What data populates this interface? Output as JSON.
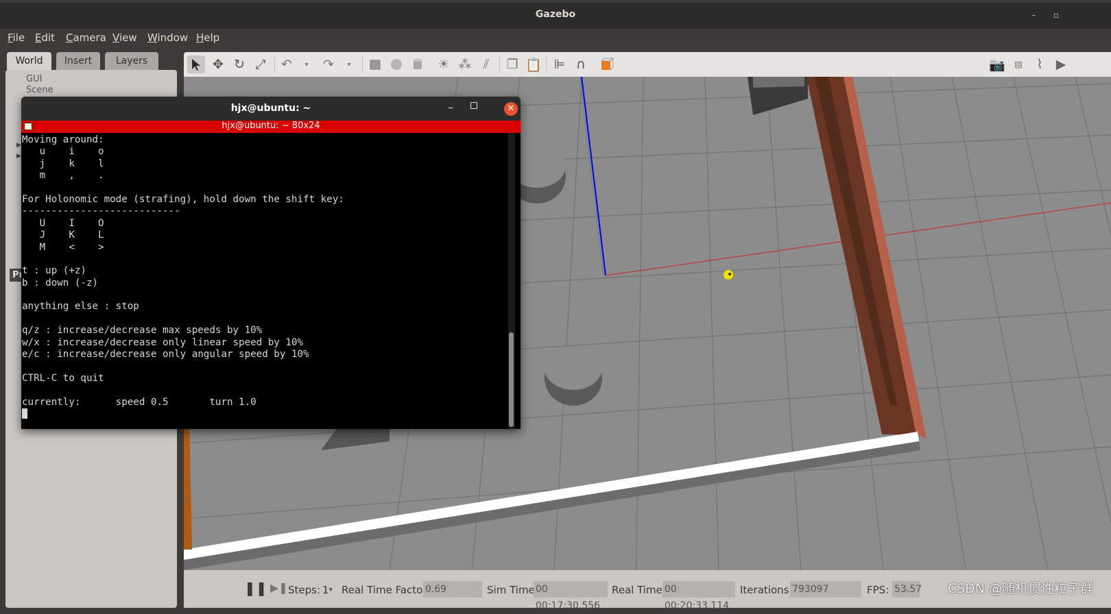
{
  "window": {
    "title": "Gazebo",
    "controls": [
      "–",
      "▫"
    ]
  },
  "menu": [
    "File",
    "Edit",
    "Camera",
    "View",
    "Window",
    "Help"
  ],
  "left_panel": {
    "tabs": [
      "World",
      "Insert",
      "Layers"
    ],
    "tree": [
      "GUI",
      "Scene"
    ],
    "properties_label": "Pr"
  },
  "toolbar": {
    "icons": [
      "select-arrow-icon",
      "translate-icon",
      "rotate-icon",
      "scale-icon",
      "undo-icon",
      "undo-history-icon",
      "redo-icon",
      "redo-history-icon",
      "box-shape-icon",
      "sphere-shape-icon",
      "cylinder-shape-icon",
      "point-light-icon",
      "spot-light-icon",
      "directional-light-icon",
      "copy-icon",
      "paste-icon",
      "align-icon",
      "snap-icon",
      "view-angle-icon",
      "screenshot-icon",
      "log-icon",
      "plot-icon",
      "record-video-icon"
    ]
  },
  "terminal": {
    "window_title": "hjx@ubuntu: ~",
    "tab_title": "hjx@ubuntu: ~ 80x24",
    "lines": [
      "Moving around:",
      "   u    i    o",
      "   j    k    l",
      "   m    ,    .",
      "",
      "For Holonomic mode (strafing), hold down the shift key:",
      "---------------------------",
      "   U    I    O",
      "   J    K    L",
      "   M    <    >",
      "",
      "t : up (+z)",
      "b : down (-z)",
      "",
      "anything else : stop",
      "",
      "q/z : increase/decrease max speeds by 10%",
      "w/x : increase/decrease only linear speed by 10%",
      "e/c : increase/decrease only angular speed by 10%",
      "",
      "CTRL-C to quit",
      "",
      "currently:      speed 0.5       turn 1.0"
    ]
  },
  "status": {
    "steps_label": "Steps:",
    "steps_value": "1",
    "rtf_label": "Real Time Factor:",
    "rtf_value": "0.69",
    "sim_time_label": "Sim Time:",
    "sim_time_value": "00 00:17:30.556",
    "real_time_label": "Real Time:",
    "real_time_value": "00 00:20:33.114",
    "iterations_label": "Iterations:",
    "iterations_value": "793097",
    "fps_label": "FPS:",
    "fps_value": "53.57",
    "watermark": "CSDN @随机惯性粒子群"
  },
  "colors": {
    "terminal_tab_bar": "#d90000",
    "close_button": "#e8542f",
    "axis_x": "#c0392b",
    "axis_y": "#2e8b57",
    "axis_z": "#0000ff",
    "robot": "#f0e000"
  }
}
